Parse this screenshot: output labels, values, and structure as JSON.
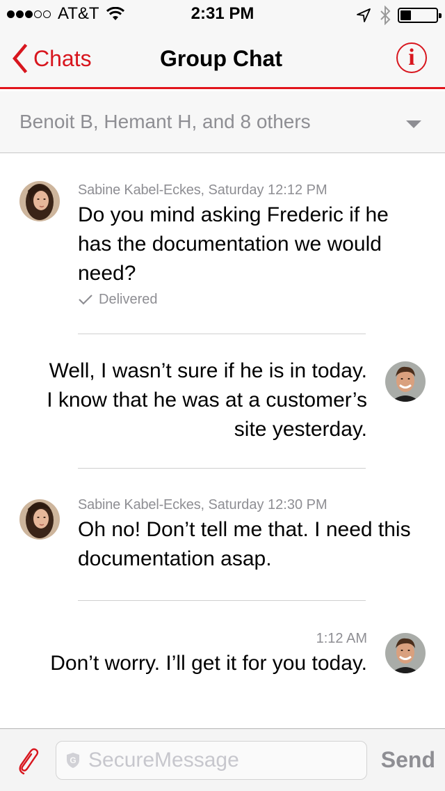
{
  "status_bar": {
    "signal_bars_filled": 3,
    "signal_bars_total": 5,
    "carrier": "AT&T",
    "time": "2:31 PM",
    "icons": [
      "wifi-icon",
      "location-arrow-icon",
      "bluetooth-icon",
      "battery-icon"
    ],
    "battery_level": 0.3
  },
  "nav": {
    "back_label": "Chats",
    "title": "Group Chat",
    "info_icon": "i",
    "accent_color": "#d8161e"
  },
  "participants": {
    "label": "Benoit B, Hemant H, and 8 others"
  },
  "messages": [
    {
      "direction": "incoming",
      "sender": "Sabine Kabel-Eckes,",
      "timestamp": "Saturday 12:12 PM",
      "text": "Do you mind asking Frederic if he has the documentation we would need?",
      "status": "Delivered"
    },
    {
      "direction": "outgoing",
      "text": "Well, I wasn’t sure if he is in today. I know that he was at a customer’s site yesterday."
    },
    {
      "direction": "incoming",
      "sender": "Sabine Kabel-Eckes,",
      "timestamp": "Saturday 12:30 PM",
      "text": "Oh no! Don’t tell me that. I need this documentation asap."
    },
    {
      "direction": "outgoing",
      "timestamp": "1:12 AM",
      "text": "Don’t worry. I’ll get it for you today."
    }
  ],
  "composer": {
    "placeholder": "SecureMessage",
    "value": "",
    "send_label": "Send"
  }
}
